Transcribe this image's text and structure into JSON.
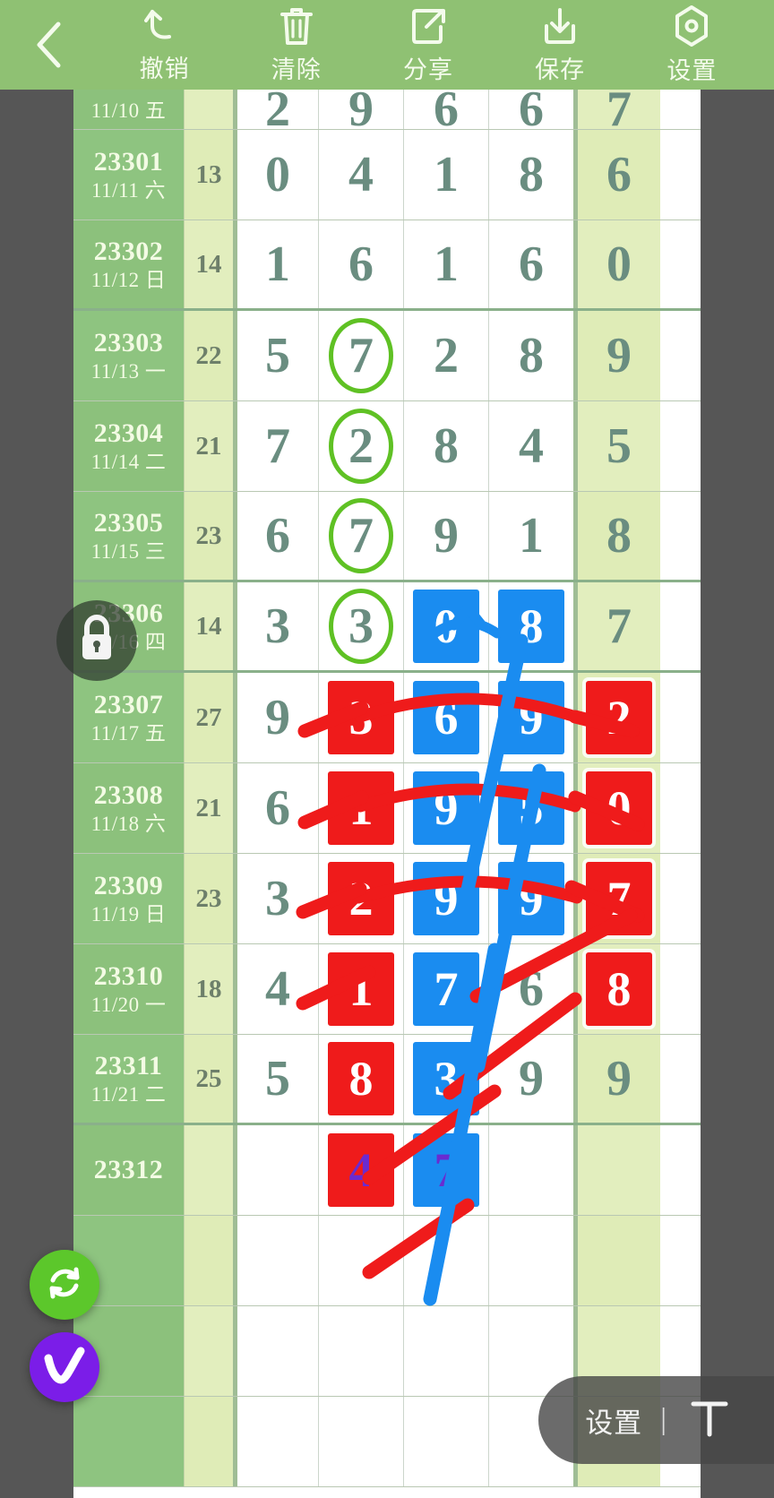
{
  "toolbar": {
    "back_icon": "chevron-left-icon",
    "items": [
      {
        "label": "撤销",
        "icon": "undo-arrow-icon"
      },
      {
        "label": "清除",
        "icon": "trash-icon"
      },
      {
        "label": "分享",
        "icon": "share-icon"
      },
      {
        "label": "保存",
        "icon": "save-download-icon"
      },
      {
        "label": "设置",
        "icon": "settings-hex-icon"
      }
    ]
  },
  "colors": {
    "toolbar_bg": "#8fc173",
    "issue_col_bg": "#8cc17c",
    "sum_col_bg": "#e2eebe",
    "digit_text": "#6a8d80",
    "mark_red": "#ef1b1b",
    "mark_blue": "#1a8cf0",
    "mark_circle_green": "#5fc124",
    "prediction_purple": "#6a2bd0",
    "fab_refresh": "#5cc72b",
    "fab_check": "#7b1de8"
  },
  "table": {
    "rows": [
      {
        "issue": "",
        "date": "11/10 五",
        "sum": "",
        "digits": [
          "2",
          "9",
          "6",
          "6"
        ],
        "tail": "7",
        "marks": [
          "",
          "",
          "",
          ""
        ],
        "partial": true
      },
      {
        "issue": "23301",
        "date": "11/11 六",
        "sum": "13",
        "digits": [
          "0",
          "4",
          "1",
          "8"
        ],
        "tail": "6",
        "marks": [
          "",
          "",
          "",
          ""
        ]
      },
      {
        "issue": "23302",
        "date": "11/12 日",
        "sum": "14",
        "digits": [
          "1",
          "6",
          "1",
          "6"
        ],
        "tail": "0",
        "marks": [
          "",
          "",
          "",
          ""
        ]
      },
      {
        "issue": "23303",
        "date": "11/13 一",
        "sum": "22",
        "digits": [
          "5",
          "7",
          "2",
          "8"
        ],
        "tail": "9",
        "marks": [
          "",
          "circle",
          "",
          ""
        ]
      },
      {
        "issue": "23304",
        "date": "11/14 二",
        "sum": "21",
        "digits": [
          "7",
          "2",
          "8",
          "4"
        ],
        "tail": "5",
        "marks": [
          "",
          "circle",
          "",
          ""
        ]
      },
      {
        "issue": "23305",
        "date": "11/15 三",
        "sum": "23",
        "digits": [
          "6",
          "7",
          "9",
          "1"
        ],
        "tail": "8",
        "marks": [
          "",
          "circle",
          "",
          ""
        ]
      },
      {
        "issue": "23306",
        "date": "11/16 四",
        "sum": "14",
        "digits": [
          "3",
          "3",
          "0",
          "8"
        ],
        "tail": "7",
        "marks": [
          "",
          "circle",
          "blue",
          "blue"
        ]
      },
      {
        "issue": "23307",
        "date": "11/17 五",
        "sum": "27",
        "digits": [
          "9",
          "3",
          "6",
          "9"
        ],
        "tail": "2",
        "marks": [
          "",
          "red",
          "blue",
          "blue"
        ],
        "tail_mark": "red"
      },
      {
        "issue": "23308",
        "date": "11/18 六",
        "sum": "21",
        "digits": [
          "6",
          "1",
          "9",
          "5"
        ],
        "tail": "0",
        "marks": [
          "",
          "red",
          "blue",
          "blue"
        ],
        "tail_mark": "red"
      },
      {
        "issue": "23309",
        "date": "11/19 日",
        "sum": "23",
        "digits": [
          "3",
          "2",
          "9",
          "9"
        ],
        "tail": "7",
        "marks": [
          "",
          "red",
          "blue",
          "blue"
        ],
        "tail_mark": "red"
      },
      {
        "issue": "23310",
        "date": "11/20 一",
        "sum": "18",
        "digits": [
          "4",
          "1",
          "7",
          "6"
        ],
        "tail": "8",
        "marks": [
          "",
          "red",
          "blue",
          ""
        ],
        "tail_mark": "red"
      },
      {
        "issue": "23311",
        "date": "11/21 二",
        "sum": "25",
        "digits": [
          "5",
          "8",
          "3",
          "9"
        ],
        "tail": "9",
        "marks": [
          "",
          "red",
          "blue",
          ""
        ]
      },
      {
        "issue": "23312",
        "date": "",
        "sum": "",
        "digits": [
          "",
          "4",
          "7",
          ""
        ],
        "tail": "",
        "marks": [
          "",
          "pred-red",
          "pred-blue",
          ""
        ]
      },
      {
        "issue": "",
        "date": "",
        "sum": "",
        "digits": [
          "",
          "",
          "",
          ""
        ],
        "tail": "",
        "marks": [
          "",
          "",
          "",
          ""
        ]
      },
      {
        "issue": "",
        "date": "",
        "sum": "",
        "digits": [
          "",
          "",
          "",
          ""
        ],
        "tail": "",
        "marks": [
          "",
          "",
          "",
          ""
        ]
      },
      {
        "issue": "",
        "date": "",
        "sum": "",
        "digits": [
          "",
          "",
          "",
          ""
        ],
        "tail": "",
        "marks": [
          "",
          "",
          "",
          ""
        ]
      }
    ]
  },
  "overlay": {
    "lock_icon": "lock-icon",
    "refresh_icon": "refresh-icon",
    "check_icon": "check-mark-icon"
  },
  "bottom_bar": {
    "settings_label": "设置",
    "separator": "|",
    "text_tool_icon": "text-T-icon"
  }
}
